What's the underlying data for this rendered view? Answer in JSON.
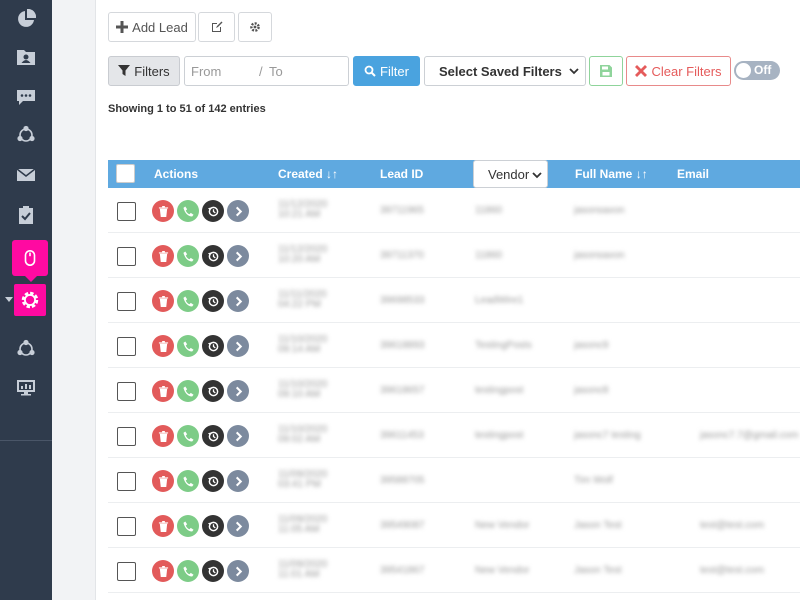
{
  "toolbar": {
    "add_lead_label": "Add Lead",
    "filters_label": "Filters",
    "from_placeholder": "From",
    "separator": "/",
    "to_placeholder": "To",
    "filter_label": "Filter",
    "saved_filters_label": "Select Saved Filters",
    "clear_filters_label": "Clear Filters",
    "toggle_label": "Off"
  },
  "showing_text": "Showing 1 to 51 of 142 entries",
  "table": {
    "headers": {
      "actions": "Actions",
      "created": "Created",
      "lead_id": "Lead ID",
      "vendor": "Vendor",
      "full_name": "Full Name",
      "email": "Email"
    },
    "rows": [
      {
        "created": "11/12/2020 10:21 AM",
        "lead_id": "39711965",
        "vendor": "11860",
        "full_name": "jasonsaxon",
        "email": ""
      },
      {
        "created": "11/12/2020 10:20 AM",
        "lead_id": "39711370",
        "vendor": "11860",
        "full_name": "jasonsaxon",
        "email": ""
      },
      {
        "created": "11/11/2020 04:22 PM",
        "lead_id": "39698533",
        "vendor": "LeadWire1",
        "full_name": "",
        "email": ""
      },
      {
        "created": "11/10/2020 09:14 AM",
        "lead_id": "39618893",
        "vendor": "TestingPosts",
        "full_name": "jasonc9",
        "email": ""
      },
      {
        "created": "11/10/2020 09:10 AM",
        "lead_id": "39618657",
        "vendor": "testingpost",
        "full_name": "jasonc8",
        "email": ""
      },
      {
        "created": "11/10/2020 09:02 AM",
        "lead_id": "39611453",
        "vendor": "testingpost",
        "full_name": "jasonc7 testing",
        "email": "jasonc7.7@gmail.com"
      },
      {
        "created": "11/09/2020 03:41 PM",
        "lead_id": "39588705",
        "vendor": "",
        "full_name": "Tim Wolf",
        "email": ""
      },
      {
        "created": "11/09/2020 11:05 AM",
        "lead_id": "39549087",
        "vendor": "New Vendor",
        "full_name": "Jason Test",
        "email": "test@test.com"
      },
      {
        "created": "11/09/2020 11:01 AM",
        "lead_id": "39541867",
        "vendor": "New Vendor",
        "full_name": "Jason Test",
        "email": "test@test.com"
      }
    ]
  },
  "colors": {
    "sidebar_bg": "#2f3b4c",
    "accent_pink": "#ff0aa1",
    "header_blue": "#5fa9e0",
    "filter_blue": "#4aa3df",
    "delete_red": "#e25a5a",
    "call_green": "#7dcc87",
    "history_dark": "#333333",
    "go_grey": "#7c8a9e"
  },
  "sidebar": {
    "icons": [
      "pie-chart-icon",
      "contacts-folder-icon",
      "chat-icon",
      "share-nodes-icon",
      "mail-icon",
      "clipboard-check-icon",
      "mouse-icon",
      "gear-icon",
      "share-nodes-icon",
      "monitor-chart-icon"
    ]
  }
}
